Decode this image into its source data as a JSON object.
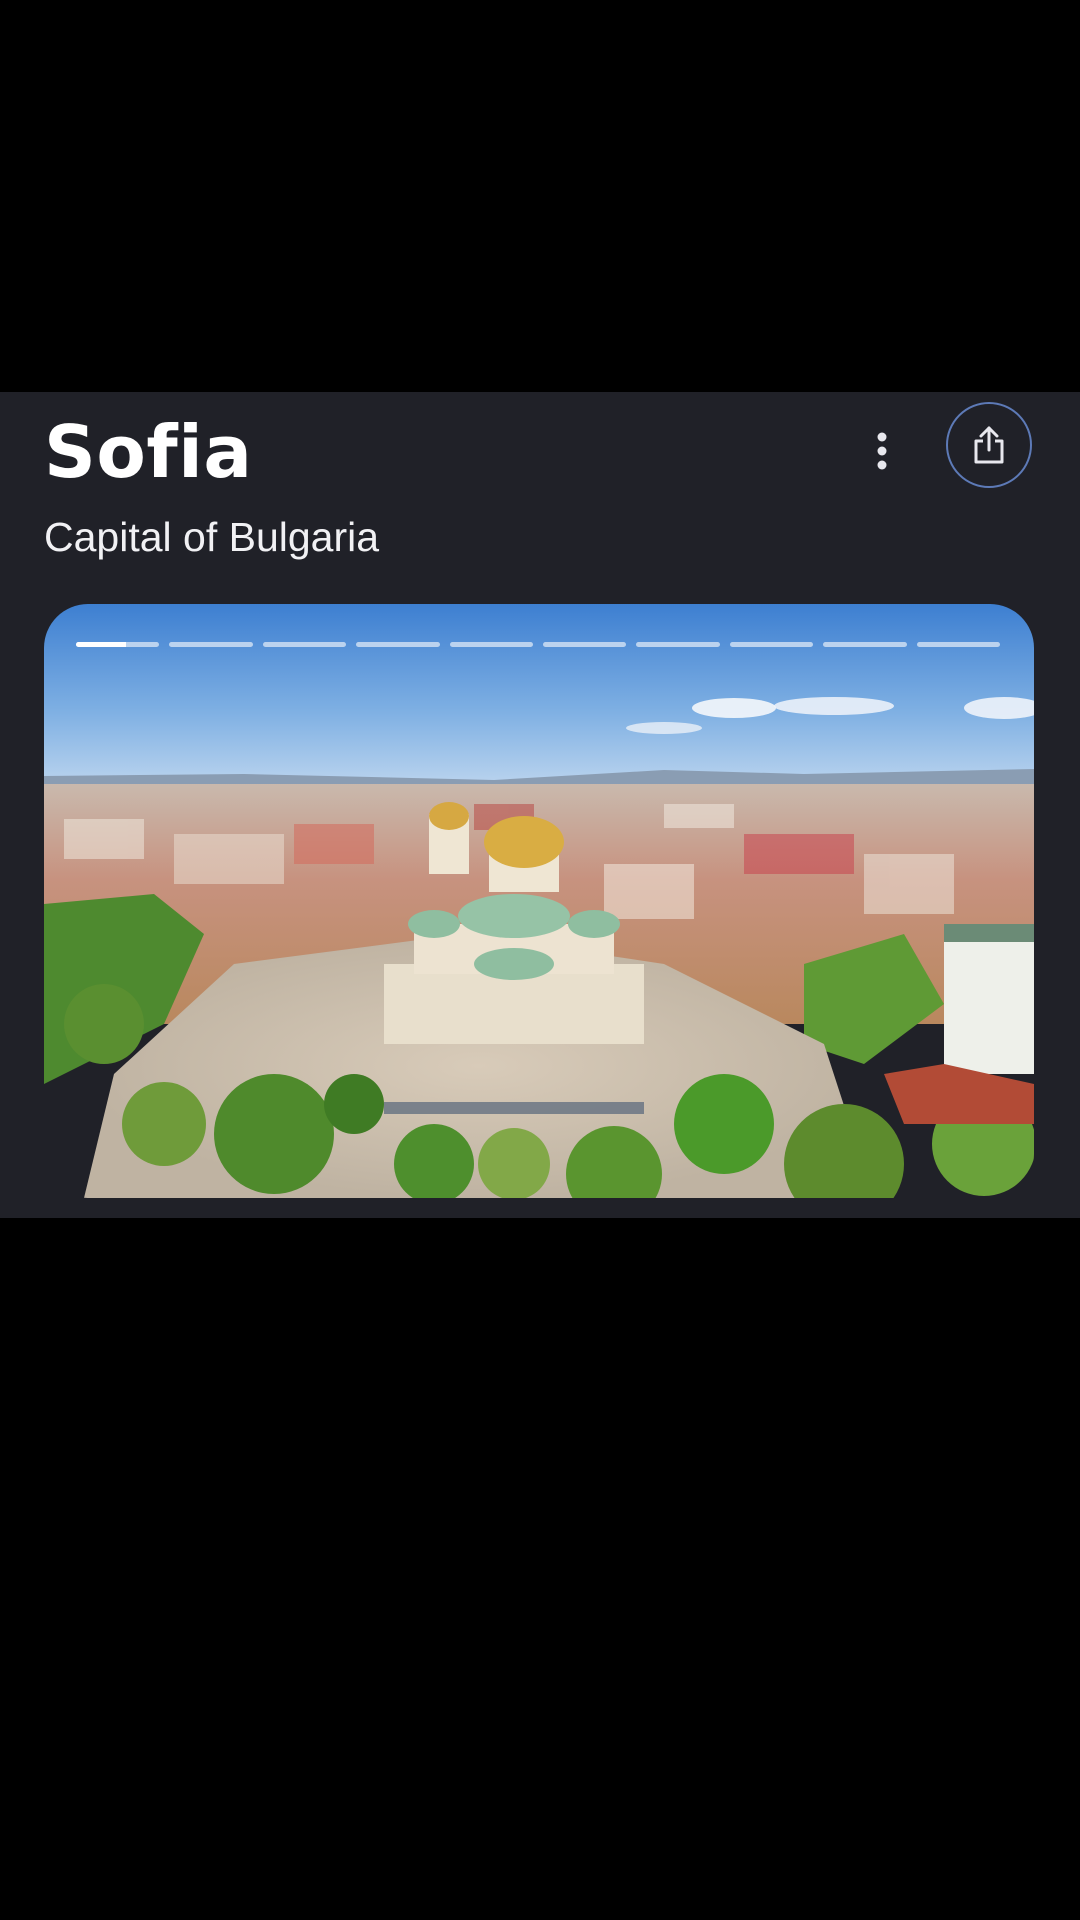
{
  "place": {
    "title": "Sofia",
    "subtitle": "Capital of Bulgaria"
  },
  "icons": {
    "more": "more-vert-icon",
    "share": "share-icon"
  },
  "colors": {
    "card_background": "#202128",
    "share_ring": "#5d7ab7",
    "text": "#ffffff"
  },
  "gallery": {
    "image_subject": "aerial-city-cathedral",
    "segments_total": 10,
    "active_segment": 1,
    "active_segment_progress": 0.6
  }
}
